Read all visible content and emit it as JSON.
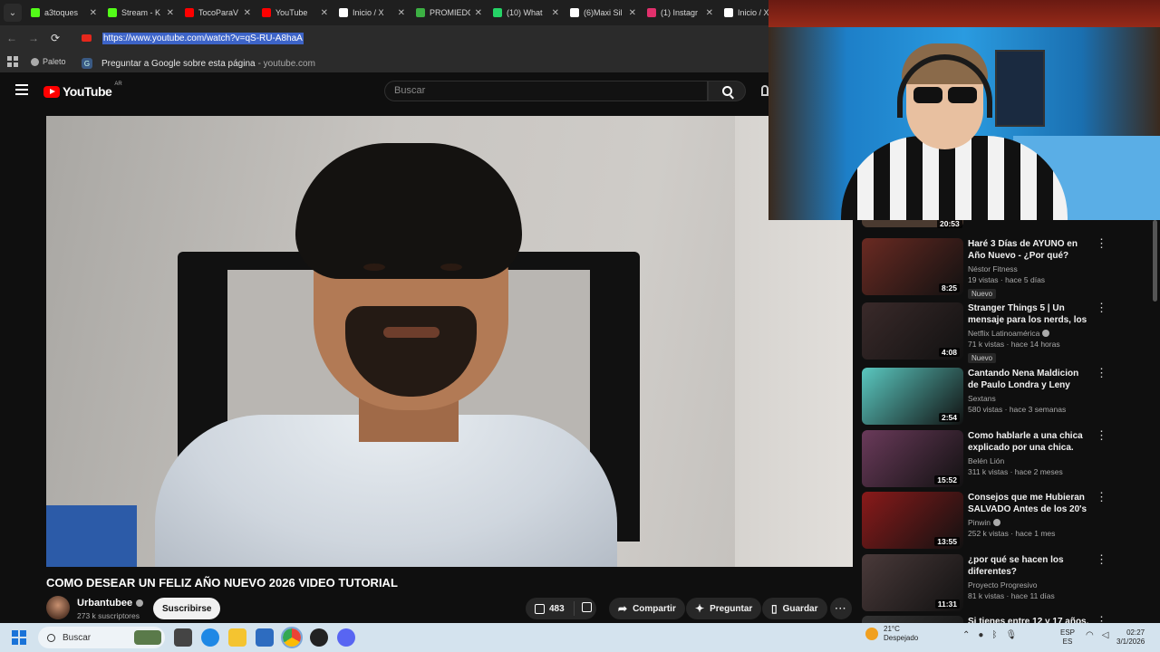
{
  "browser": {
    "tabs": [
      {
        "title": "a3toques",
        "color": "#53fc18"
      },
      {
        "title": "Stream - K",
        "color": "#53fc18"
      },
      {
        "title": "TocoParaV",
        "color": "#ff0000"
      },
      {
        "title": "YouTube",
        "color": "#ff0000"
      },
      {
        "title": "Inicio / X",
        "color": "#ffffff"
      },
      {
        "title": "PROMIEDC",
        "color": "#3cb043"
      },
      {
        "title": "(10) What",
        "color": "#25d366"
      },
      {
        "title": "(6)Maxi Sil",
        "color": "#ffffff"
      },
      {
        "title": "(1) Instagr",
        "color": "#e1306c"
      },
      {
        "title": "Inicio / X",
        "color": "#ffffff"
      }
    ],
    "url": "https://www.youtube.com/watch?v=qS-RU-A8haA",
    "bookmark": "Paleto",
    "suggestion": "Preguntar a Google sobre esta página",
    "suggestion_domain": "- youtube.com"
  },
  "youtube": {
    "logo": "YouTube",
    "region": "AR",
    "search_placeholder": "Buscar"
  },
  "video": {
    "title": "COMO DESEAR UN FELIZ AÑO NUEVO 2026 VIDEO TUTORIAL",
    "channel": "Urbantubee",
    "subscribers": "273 k suscriptores",
    "subscribe_label": "Suscribirse",
    "likes": "483",
    "share_label": "Compartir",
    "ask_label": "Preguntar",
    "save_label": "Guardar"
  },
  "sidebar": {
    "previous_duration": "20:53",
    "recommendations": [
      {
        "title": "Haré 3 Días de AYUNO en Año Nuevo - ¿Por qué?",
        "channel": "Néstor Fitness",
        "verified": false,
        "meta": "19 vistas · hace 5 días",
        "badge": "Nuevo",
        "duration": "8:25",
        "thumb_color": "#6a2a22"
      },
      {
        "title": "Stranger Things 5 | Un mensaje para los nerds, los freaks y los...",
        "channel": "Netflix Latinoamérica",
        "verified": true,
        "meta": "71 k vistas · hace 14 horas",
        "badge": "Nuevo",
        "duration": "4:08",
        "thumb_color": "#3a2a2a"
      },
      {
        "title": "Cantando Nena Maldicion de Paulo Londra y Leny Tavares",
        "channel": "Sextans",
        "verified": false,
        "meta": "580 vistas · hace 3 semanas",
        "badge": "",
        "duration": "2:54",
        "thumb_color": "#5ac8c0"
      },
      {
        "title": "Como hablarle a una chica explicado por una chica.",
        "channel": "Belén Lión",
        "verified": false,
        "meta": "311 k vistas · hace 2 meses",
        "badge": "",
        "duration": "15:52",
        "thumb_color": "#6a3a5a"
      },
      {
        "title": "Consejos que me Hubieran SALVADO Antes de los 20's",
        "channel": "Pinwin",
        "verified": true,
        "meta": "252 k vistas · hace 1 mes",
        "badge": "",
        "duration": "13:55",
        "thumb_color": "#8a1a1a"
      },
      {
        "title": "¿por qué se hacen los diferentes?",
        "channel": "Proyecto Progresivo",
        "verified": false,
        "meta": "81 k vistas · hace 11 días",
        "badge": "",
        "duration": "11:31",
        "thumb_color": "#4a3a3a"
      },
      {
        "title": "Si tienes entre 12 y 17 años, por",
        "channel": "",
        "verified": false,
        "meta": "",
        "badge": "",
        "duration": "",
        "thumb_color": "#333333"
      }
    ]
  },
  "taskbar": {
    "search_placeholder": "Buscar",
    "temperature": "21°C",
    "weather": "Despejado",
    "lang1": "ESP",
    "lang2": "ES",
    "time": "02:27",
    "date": "3/1/2026"
  }
}
